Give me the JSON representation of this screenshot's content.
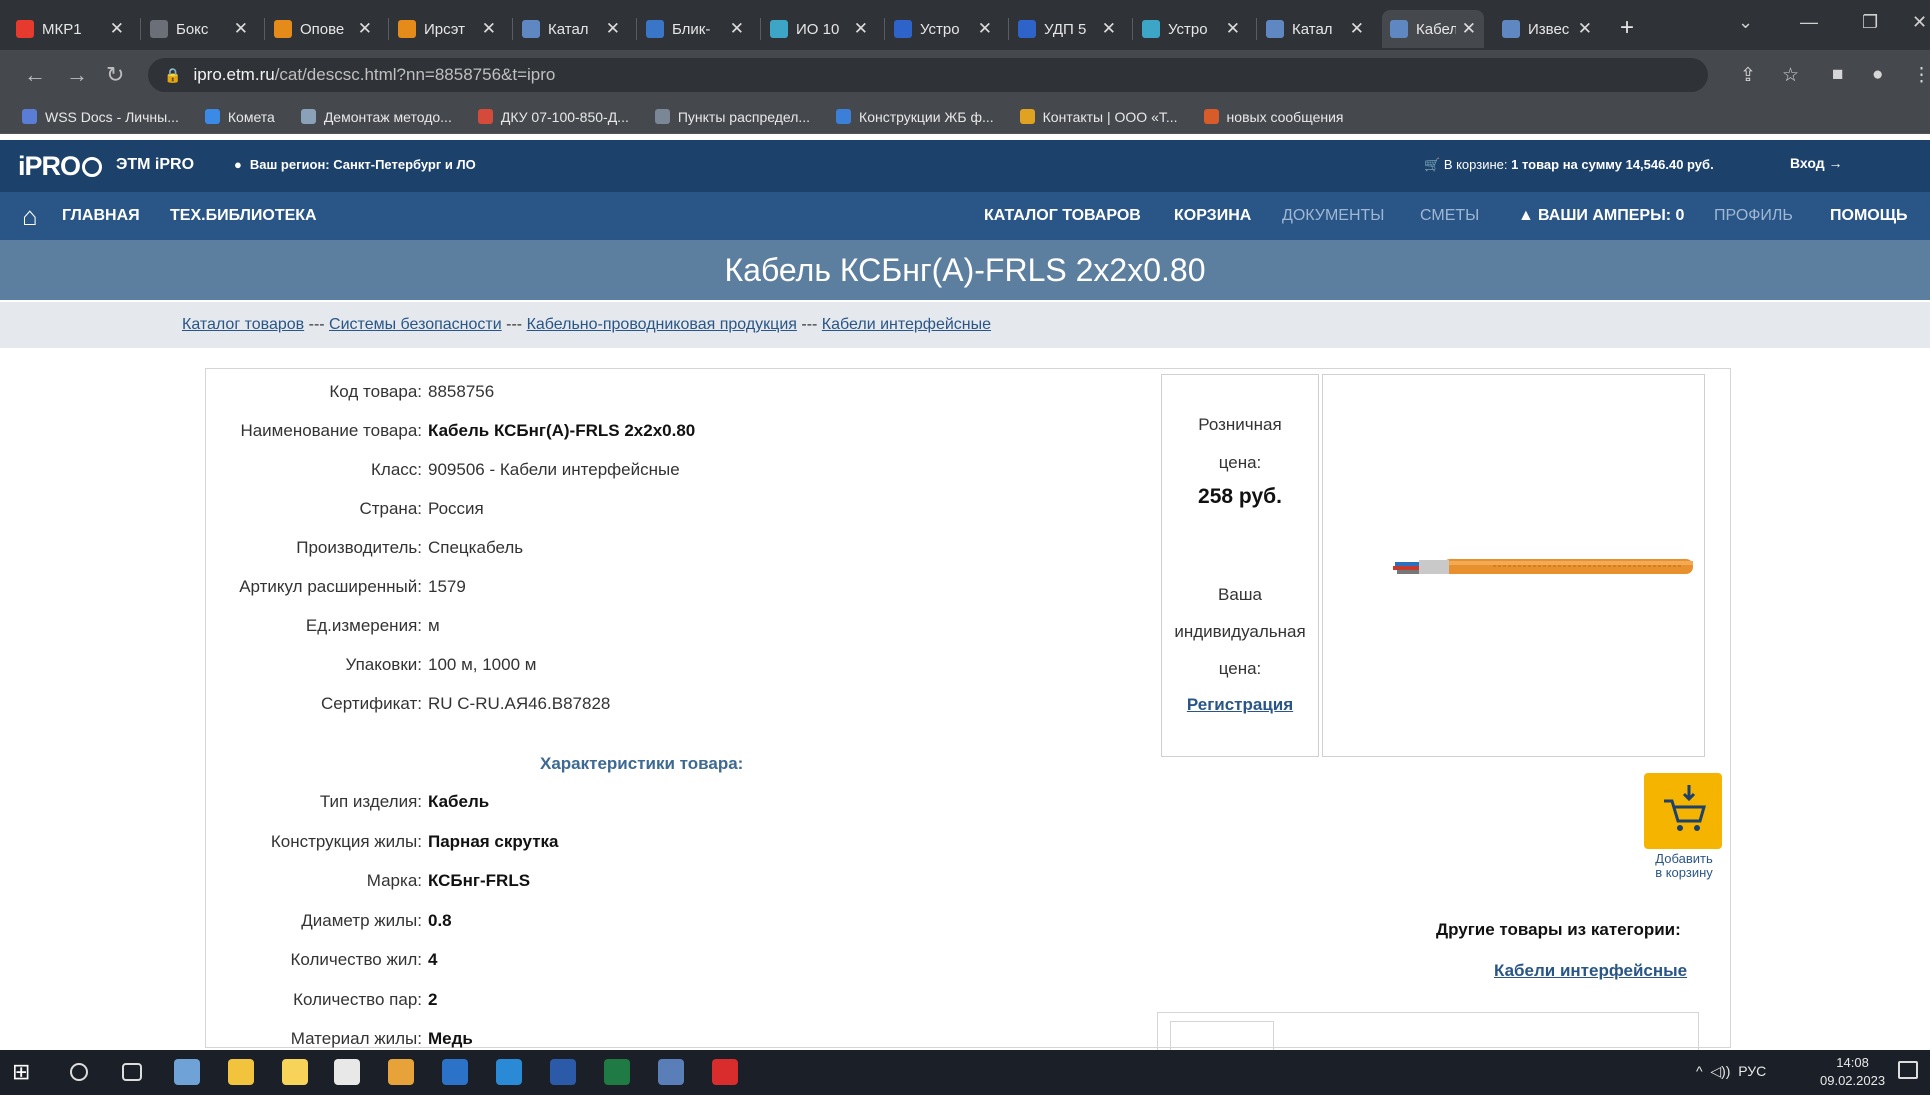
{
  "browser": {
    "tabs": [
      {
        "label": "МКР1",
        "color": "#e63a2e"
      },
      {
        "label": "Бокс",
        "color": "#6b6f78"
      },
      {
        "label": "Опове",
        "color": "#e58b1a"
      },
      {
        "label": "Ирсэт",
        "color": "#e58b1a"
      },
      {
        "label": "Катал",
        "color": "#5f88c2"
      },
      {
        "label": "Блик-",
        "color": "#3a76c8"
      },
      {
        "label": "ИО 10",
        "color": "#3da6c6"
      },
      {
        "label": "Устро",
        "color": "#2e64c9"
      },
      {
        "label": "УДП 5",
        "color": "#2e64c9"
      },
      {
        "label": "Устро",
        "color": "#3da6c6"
      },
      {
        "label": "Катал",
        "color": "#5f88c2"
      },
      {
        "label": "Кабел",
        "color": "#5f88c2",
        "active": true
      },
      {
        "label": "Извес",
        "color": "#5f88c2"
      }
    ],
    "url_host": "ipro.etm.ru",
    "url_path": "/cat/descsc.html?nn=8858756&t=ipro",
    "bookmarks": [
      {
        "label": "WSS Docs - Личны...",
        "color": "#5a7ed6"
      },
      {
        "label": "Комета",
        "color": "#3a8ae6"
      },
      {
        "label": "Демонтаж методо...",
        "color": "#8aa1b8"
      },
      {
        "label": "ДКУ 07-100-850-Д...",
        "color": "#d44b3b"
      },
      {
        "label": "Пункты распредел...",
        "color": "#7b8797"
      },
      {
        "label": "Конструкции ЖБ ф...",
        "color": "#3b7fd8"
      },
      {
        "label": "Контакты | ООО «Т...",
        "color": "#e0a321"
      },
      {
        "label": "новых сообщения",
        "color": "#d85b2a"
      }
    ]
  },
  "site": {
    "logo": "iPRO",
    "brand": "ЭТМ iPRO",
    "region": "Ваш регион: Санкт-Петербург и ЛО",
    "cart_prefix": "В корзине:",
    "cart_summary": "1 товар на сумму 14,546.40 руб.",
    "login": "Вход",
    "nav_left": [
      "ГЛАВНАЯ",
      "ТЕХ.БИБЛИОТЕКА"
    ],
    "nav_right": [
      {
        "label": "КАТАЛОГ ТОВАРОВ",
        "dim": false
      },
      {
        "label": "КОРЗИНА",
        "dim": false
      },
      {
        "label": "ДОКУМЕНТЫ",
        "dim": true
      },
      {
        "label": "СМЕТЫ",
        "dim": true
      },
      {
        "label": "ВАШИ АМПЕРЫ: 0",
        "dim": false
      },
      {
        "label": "ПРОФИЛЬ",
        "dim": true
      },
      {
        "label": "ПОМОЩЬ",
        "dim": false
      }
    ]
  },
  "page": {
    "title": "Кабель КСБнг(А)-FRLS 2x2x0.80",
    "breadcrumbs": [
      "Каталог товаров",
      "Системы безопасности",
      "Кабельно-проводниковая продукция",
      "Кабели интерфейсные"
    ],
    "breadcrumb_sep": " --- "
  },
  "product": {
    "fields": [
      {
        "k": "Код товара:",
        "v": "8858756",
        "bold": false
      },
      {
        "k": "Наименование товара:",
        "v": "Кабель КСБнг(А)-FRLS 2x2x0.80",
        "bold": true
      },
      {
        "k": "Класс:",
        "v": "909506 - Кабели интерфейсные",
        "bold": false
      },
      {
        "k": "Страна:",
        "v": "Россия",
        "bold": false
      },
      {
        "k": "Производитель:",
        "v": "Спецкабель",
        "bold": false
      },
      {
        "k": "Артикул расширенный:",
        "v": "1579",
        "bold": false
      },
      {
        "k": "Ед.измерения:",
        "v": "м",
        "bold": false
      },
      {
        "k": "Упаковки:",
        "v": "100 м, 1000 м",
        "bold": false
      },
      {
        "k": "Сертификат:",
        "v": "RU C-RU.АЯ46.В87828",
        "bold": false
      }
    ],
    "characteristics_title": "Характеристики товара:",
    "characteristics": [
      {
        "k": "Тип изделия:",
        "v": "Кабель"
      },
      {
        "k": "Конструкция жилы:",
        "v": "Парная скрутка"
      },
      {
        "k": "Марка:",
        "v": "КСБнг-FRLS"
      },
      {
        "k": "Диаметр жилы:",
        "v": "0.8"
      },
      {
        "k": "Количество жил:",
        "v": "4"
      },
      {
        "k": "Количество пар:",
        "v": "2"
      },
      {
        "k": "Материал жилы:",
        "v": "Медь"
      }
    ],
    "retail_label_1": "Розничная",
    "retail_label_2": "цена:",
    "retail_price": "258 руб.",
    "individual_1": "Ваша",
    "individual_2": "индивидуальная",
    "individual_3": "цена:",
    "register_link": "Регистрация",
    "add_to_cart_1": "Добавить",
    "add_to_cart_2": "в корзину",
    "other_title": "Другие товары из категории:",
    "other_link": "Кабели интерфейсные"
  },
  "taskbar": {
    "apps": [
      {
        "name": "windows-start-icon",
        "color": "#ffffff"
      },
      {
        "name": "search-icon",
        "color": "#1b2028"
      },
      {
        "name": "task-view-icon",
        "color": "#1b2028"
      },
      {
        "name": "app-icon-1",
        "color": "#6fa3d8"
      },
      {
        "name": "explorer-icon",
        "color": "#f2c33c"
      },
      {
        "name": "store-icon",
        "color": "#f7d35a"
      },
      {
        "name": "mail-icon",
        "color": "#e8e8e8"
      },
      {
        "name": "chrome-icon",
        "color": "#e8a23a"
      },
      {
        "name": "outlook-icon",
        "color": "#2a73c8"
      },
      {
        "name": "app-icon-2",
        "color": "#2b8ad6"
      },
      {
        "name": "word-icon",
        "color": "#2b5aa8"
      },
      {
        "name": "excel-icon",
        "color": "#1f7a44"
      },
      {
        "name": "app-icon-3",
        "color": "#5a7fb8"
      },
      {
        "name": "acrobat-icon",
        "color": "#d92c2c"
      }
    ],
    "tray_lang": "РУС",
    "time": "14:08",
    "date": "09.02.2023"
  }
}
